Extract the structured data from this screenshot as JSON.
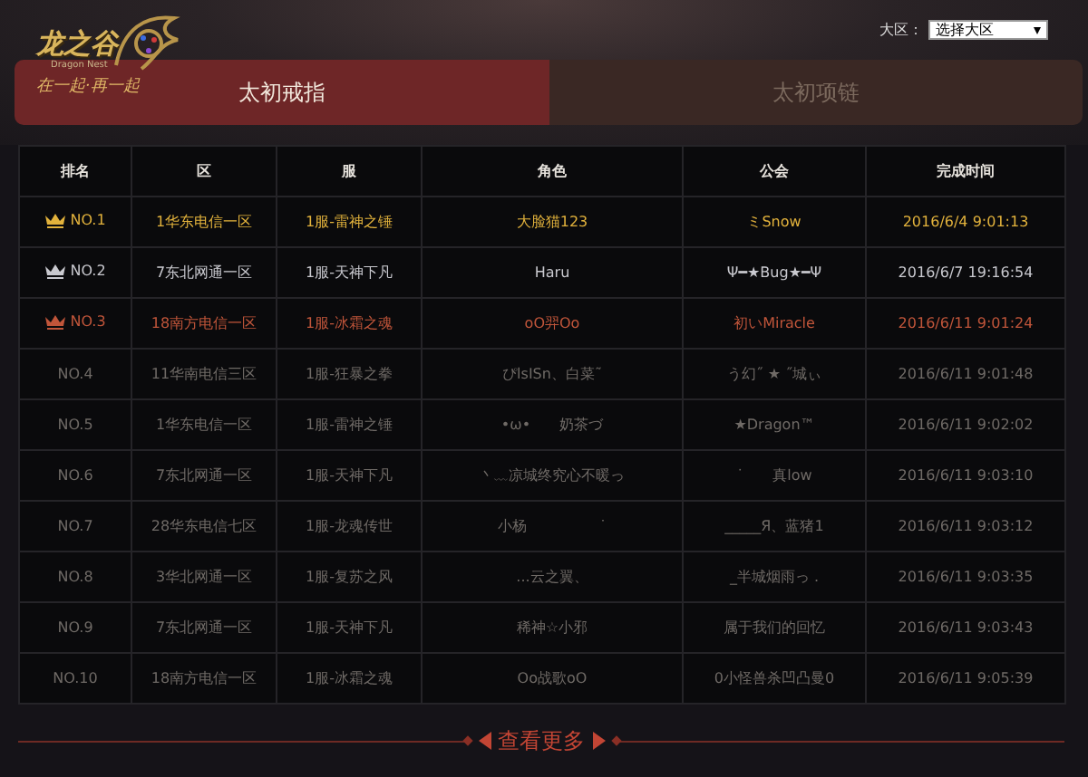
{
  "logo": {
    "title": "龙之谷",
    "subtitle": "Dragon Nest",
    "slogan": "在一起·再一起"
  },
  "region_select": {
    "label": "大区：",
    "value": "选择大区"
  },
  "tabs": [
    {
      "label": "太初戒指",
      "selected": true
    },
    {
      "label": "太初项链",
      "selected": false
    }
  ],
  "table": {
    "columns": [
      "排名",
      "区",
      "服",
      "角色",
      "公会",
      "完成时间"
    ],
    "rows": [
      {
        "kind": "gold",
        "cells": [
          "NO.1",
          "1华东电信一区",
          "1服-雷神之锤",
          "大脸猫123",
          "ミSnow",
          "2016/6/4 9:01:13"
        ]
      },
      {
        "kind": "silver",
        "cells": [
          "NO.2",
          "7东北网通一区",
          "1服-天神下凡",
          "Haru",
          "Ψ━★Bug★━Ψ",
          "2016/6/7 19:16:54"
        ]
      },
      {
        "kind": "bronze",
        "cells": [
          "NO.3",
          "18南方电信一区",
          "1服-冰霜之魂",
          "oO羿Oo",
          "初いMiracle",
          "2016/6/11 9:01:24"
        ]
      },
      {
        "kind": "plain",
        "cells": [
          "NO.4",
          "11华南电信三区",
          "1服-狂暴之拳",
          "ぴlsISn、白菜˜",
          "う幻˝ ★ ˝城ぃ",
          "2016/6/11 9:01:48"
        ]
      },
      {
        "kind": "plain",
        "cells": [
          "NO.5",
          "1华东电信一区",
          "1服-雷神之锤",
          "•ω•　　奶茶づ",
          "★Dragon™",
          "2016/6/11 9:02:02"
        ]
      },
      {
        "kind": "plain",
        "cells": [
          "NO.6",
          "7东北网通一区",
          "1服-天神下凡",
          "丶﹏凉城终究心不暖っ",
          "˙　　真low",
          "2016/6/11 9:03:10"
        ]
      },
      {
        "kind": "plain",
        "cells": [
          "NO.7",
          "28华东电信七区",
          "1服-龙魂传世",
          "小杨　　　　　˙",
          "_____Я、蓝猪1",
          "2016/6/11 9:03:12"
        ]
      },
      {
        "kind": "plain",
        "cells": [
          "NO.8",
          "3华北网通一区",
          "1服-复苏之风",
          "...云之翼、",
          "_半城烟雨っ .",
          "2016/6/11 9:03:35"
        ]
      },
      {
        "kind": "plain",
        "cells": [
          "NO.9",
          "7东北网通一区",
          "1服-天神下凡",
          "稀神☆小邪",
          "属于我们的回忆",
          "2016/6/11 9:03:43"
        ]
      },
      {
        "kind": "plain",
        "cells": [
          "NO.10",
          "18南方电信一区",
          "1服-冰霜之魂",
          "Oo战歌oO",
          "0小怪兽杀凹凸曼0",
          "2016/6/11 9:05:39"
        ]
      }
    ]
  },
  "more_link": "查看更多"
}
